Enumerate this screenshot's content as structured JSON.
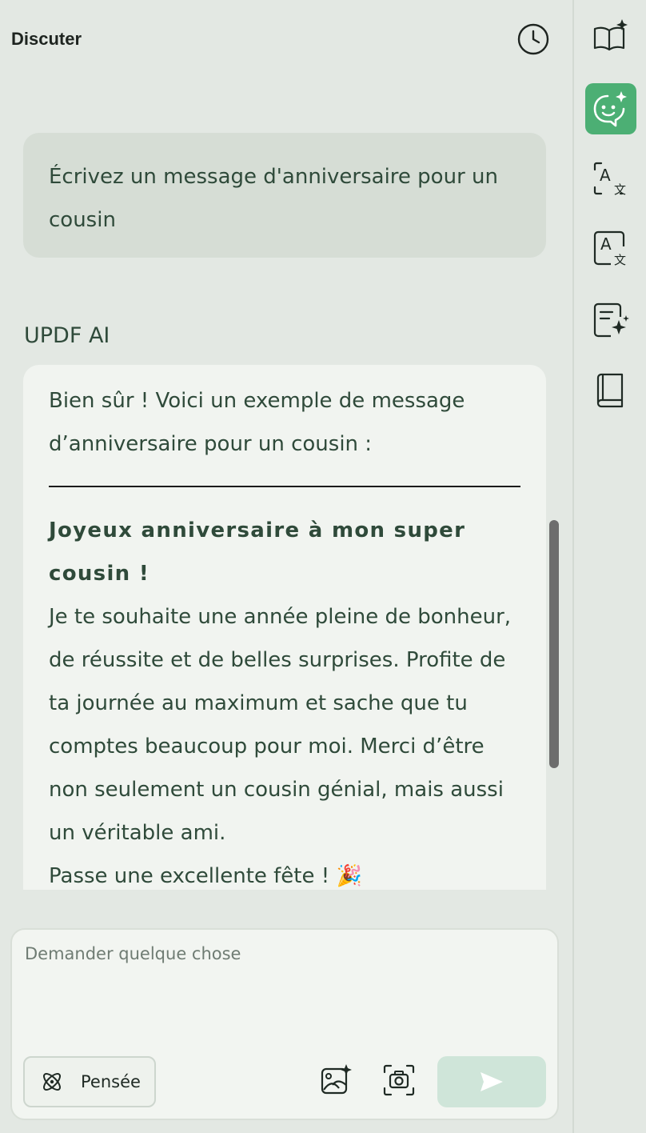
{
  "header": {
    "title": "Discuter"
  },
  "conversation": {
    "user_message": "Écrivez un message d'anniversaire pour un cousin",
    "ai_label": "UPDF AI",
    "ai_intro": "Bien sûr ! Voici un exemple de message d’anniversaire pour un cousin :",
    "ai_greeting": "Joyeux anniversaire à mon super cousin !",
    "ai_body": "Je te souhaite une année pleine de bonheur, de réussite et de belles surprises. Profite de ta journée au maximum et sache que tu comptes beaucoup pour moi. Merci d’être non seulement un cousin génial, mais aussi un véritable ami.",
    "ai_closing": "Passe une excellente fête ! 🎉"
  },
  "composer": {
    "placeholder": "Demander quelque chose",
    "value": "",
    "think_label": "Pensée"
  },
  "sidebar": {
    "items": [
      {
        "name": "book-sparkle",
        "active": false
      },
      {
        "name": "chat-ai",
        "active": true
      },
      {
        "name": "translate-scan",
        "active": false
      },
      {
        "name": "translate-document",
        "active": false
      },
      {
        "name": "summarize-sparkle",
        "active": false
      },
      {
        "name": "knowledge-book",
        "active": false
      }
    ]
  },
  "colors": {
    "accent": "#4caf74",
    "background": "#e3e8e3",
    "text": "#2f4a3a",
    "send_button": "#cfe5d9"
  }
}
